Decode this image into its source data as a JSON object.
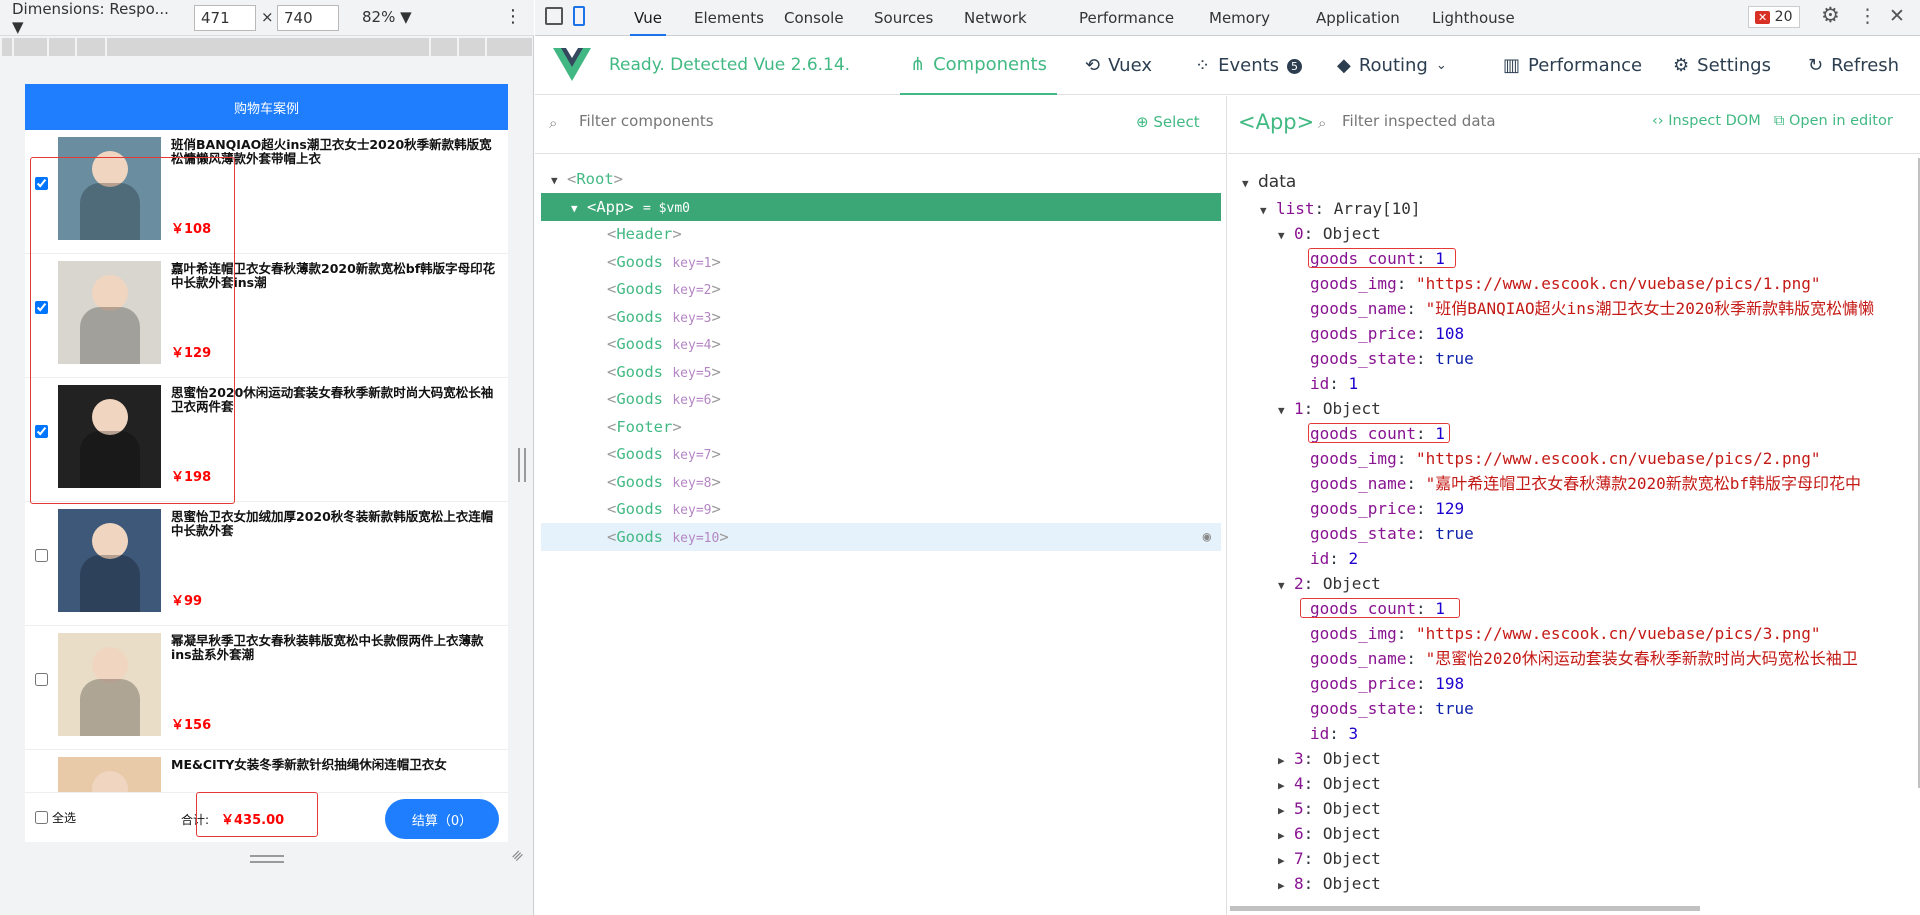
{
  "device_toolbar": {
    "dimensions_label": "Dimensions: Respo...",
    "width": "471",
    "height": "740",
    "times": "×",
    "zoom": "82%",
    "menu_icon": "kebab-icon"
  },
  "cart": {
    "header_title": "购物车案例",
    "goods": [
      {
        "name": "班俏BANQIAO超火ins潮卫衣女士2020秋季新款韩版宽松慵懒风薄款外套带帽上衣",
        "price": "￥108",
        "checked": true,
        "img_color": "#6a8ea0"
      },
      {
        "name": "嘉叶希连帽卫衣女春秋薄款2020新款宽松bf韩版字母印花中长款外套ins潮",
        "price": "￥129",
        "checked": true,
        "img_color": "#d9d6cf"
      },
      {
        "name": "思蜜怡2020休闲运动套装女春秋季新款时尚大码宽松长袖卫衣两件套",
        "price": "￥198",
        "checked": true,
        "img_color": "#222"
      },
      {
        "name": "思蜜怡卫衣女加绒加厚2020秋冬装新款韩版宽松上衣连帽中长款外套",
        "price": "￥99",
        "checked": false,
        "img_color": "#3d5878"
      },
      {
        "name": "幂凝早秋季卫衣女春秋装韩版宽松中长款假两件上衣薄款ins盐系外套潮",
        "price": "￥156",
        "checked": false,
        "img_color": "#e9ddc7"
      },
      {
        "name": "ME&CITY女装冬季新款针织抽绳休闲连帽卫衣女",
        "price": "",
        "checked": false,
        "img_color": "#e8c9a8"
      }
    ],
    "footer": {
      "select_all": "全选",
      "total_label": "合计:",
      "total_amount": "￥435.00",
      "checkout_label": "结算（0）"
    }
  },
  "devtools": {
    "tabs": [
      "Vue",
      "Elements",
      "Console",
      "Sources",
      "Network",
      "Performance",
      "Memory",
      "Application",
      "Lighthouse"
    ],
    "active_tab": "Vue",
    "error_count": "20"
  },
  "vue": {
    "ready_text": "Ready. Detected Vue 2.6.14.",
    "nav": {
      "components": "Components",
      "vuex": "Vuex",
      "events": "Events",
      "events_badge": "5",
      "routing": "Routing",
      "performance": "Performance",
      "settings": "Settings",
      "refresh": "Refresh"
    },
    "filter_components_placeholder": "Filter components",
    "select_label": "Select",
    "inspected_name": "<App>",
    "filter_inspected_placeholder": "Filter inspected data",
    "inspect_dom": "Inspect DOM",
    "open_in_editor": "Open in editor",
    "tree": [
      {
        "label": "Root",
        "key": "",
        "extra": "",
        "indent": 0,
        "arrow": "▼"
      },
      {
        "label": "App",
        "key": "",
        "extra": "= $vm0",
        "indent": 1,
        "arrow": "▼"
      },
      {
        "label": "Header",
        "key": "",
        "extra": "",
        "indent": 2,
        "arrow": ""
      },
      {
        "label": "Goods",
        "key": "key=1",
        "extra": "",
        "indent": 2,
        "arrow": ""
      },
      {
        "label": "Goods",
        "key": "key=2",
        "extra": "",
        "indent": 2,
        "arrow": ""
      },
      {
        "label": "Goods",
        "key": "key=3",
        "extra": "",
        "indent": 2,
        "arrow": ""
      },
      {
        "label": "Goods",
        "key": "key=4",
        "extra": "",
        "indent": 2,
        "arrow": ""
      },
      {
        "label": "Goods",
        "key": "key=5",
        "extra": "",
        "indent": 2,
        "arrow": ""
      },
      {
        "label": "Goods",
        "key": "key=6",
        "extra": "",
        "indent": 2,
        "arrow": ""
      },
      {
        "label": "Footer",
        "key": "",
        "extra": "",
        "indent": 2,
        "arrow": ""
      },
      {
        "label": "Goods",
        "key": "key=7",
        "extra": "",
        "indent": 2,
        "arrow": ""
      },
      {
        "label": "Goods",
        "key": "key=8",
        "extra": "",
        "indent": 2,
        "arrow": ""
      },
      {
        "label": "Goods",
        "key": "key=9",
        "extra": "",
        "indent": 2,
        "arrow": ""
      },
      {
        "label": "Goods",
        "key": "key=10",
        "extra": "",
        "indent": 2,
        "arrow": ""
      }
    ],
    "data_section": "data",
    "list_label": "list",
    "list_type": "Array[10]",
    "objects": [
      {
        "index": "0",
        "goods_count": "1",
        "goods_img": "\"https://www.escook.cn/vuebase/pics/1.png\"",
        "goods_name": "\"班俏BANQIAO超火ins潮卫衣女士2020秋季新款韩版宽松慵懒",
        "goods_price": "108",
        "goods_state": "true",
        "id": "1"
      },
      {
        "index": "1",
        "goods_count": "1",
        "goods_img": "\"https://www.escook.cn/vuebase/pics/2.png\"",
        "goods_name": "\"嘉叶希连帽卫衣女春秋薄款2020新款宽松bf韩版字母印花中",
        "goods_price": "129",
        "goods_state": "true",
        "id": "2"
      },
      {
        "index": "2",
        "goods_count": "1",
        "goods_img": "\"https://www.escook.cn/vuebase/pics/3.png\"",
        "goods_name": "\"思蜜怡2020休闲运动套装女春秋季新款时尚大码宽松长袖卫",
        "goods_price": "198",
        "goods_state": "true",
        "id": "3"
      }
    ],
    "collapsed_objects": [
      "3",
      "4",
      "5",
      "6",
      "7",
      "8"
    ],
    "object_type": "Object"
  }
}
